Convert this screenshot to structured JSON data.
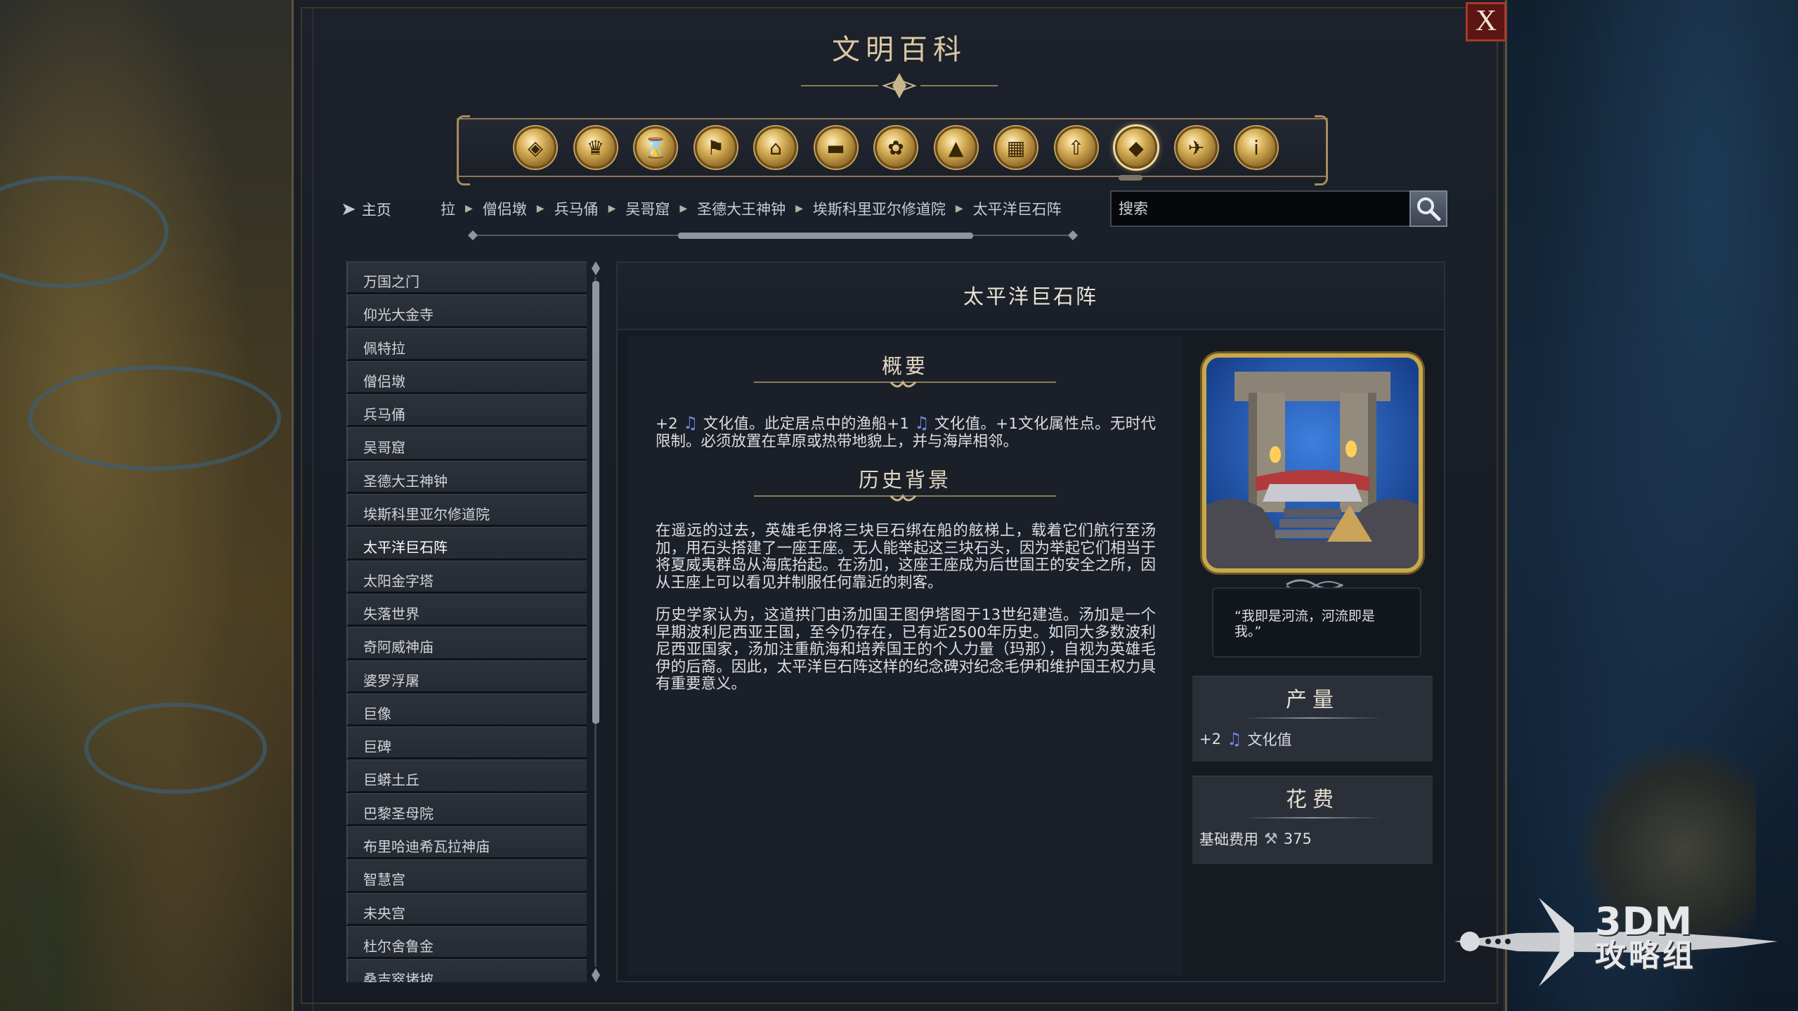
{
  "window": {
    "title": "文明百科",
    "close_label": "X"
  },
  "categories": [
    {
      "icon": "civilization-icon",
      "glyph": "◈"
    },
    {
      "icon": "leader-icon",
      "glyph": "♛"
    },
    {
      "icon": "era-hourglass-icon",
      "glyph": "⌛"
    },
    {
      "icon": "flag-icon",
      "glyph": "⚑"
    },
    {
      "icon": "building-icon",
      "glyph": "⌂"
    },
    {
      "icon": "district-icon",
      "glyph": "▬"
    },
    {
      "icon": "culture-icon",
      "glyph": "✿"
    },
    {
      "icon": "terrain-mountain-icon",
      "glyph": "▲"
    },
    {
      "icon": "city-icon",
      "glyph": "▦"
    },
    {
      "icon": "advance-arrow-icon",
      "glyph": "⇧"
    },
    {
      "icon": "wonder-icon",
      "glyph": "◆",
      "active": true
    },
    {
      "icon": "dove-icon",
      "glyph": "✈"
    },
    {
      "icon": "info-icon",
      "glyph": "i"
    }
  ],
  "nav": {
    "home_label": "主页",
    "breadcrumb": [
      "拉",
      "僧侣墩",
      "兵马俑",
      "吴哥窟",
      "圣德大王神钟",
      "埃斯科里亚尔修道院",
      "太平洋巨石阵"
    ]
  },
  "search": {
    "placeholder": "搜索"
  },
  "list": {
    "items": [
      "万国之门",
      "仰光大金寺",
      "佩特拉",
      "僧侣墩",
      "兵马俑",
      "吴哥窟",
      "圣德大王神钟",
      "埃斯科里亚尔修道院",
      "太平洋巨石阵",
      "太阳金字塔",
      "失落世界",
      "奇阿威神庙",
      "婆罗浮屠",
      "巨像",
      "巨碑",
      "巨蟒土丘",
      "巴黎圣母院",
      "布里哈迪希瓦拉神庙",
      "智慧宫",
      "未央宫",
      "杜尔舍鲁金",
      "桑吉窣堵坡"
    ],
    "selected": "太平洋巨石阵"
  },
  "detail": {
    "title": "太平洋巨石阵",
    "overview_heading": "概要",
    "overview_text_1": "+2",
    "overview_text_2": " 文化值。此定居点中的渔船+1 ",
    "overview_text_3": " 文化值。+1文化属性点。无时代限制。必须放置在草原或热带地貌上，并与海岸相邻。",
    "history_heading": "历史背景",
    "history_para_1": "在遥远的过去，英雄毛伊将三块巨石绑在船的舷梯上，载着它们航行至汤加，用石头搭建了一座王座。无人能举起这三块石头，因为举起它们相当于将夏威夷群岛从海底抬起。在汤加，这座王座成为后世国王的安全之所，因从王座上可以看见并制服任何靠近的刺客。",
    "history_para_2": "历史学家认为，这道拱门由汤加国王图伊塔图于13世纪建造。汤加是一个早期波利尼西亚王国，至今仍存在，已有近2500年历史。如同大多数波利尼西亚国家，汤加注重航海和培养国王的个人力量（玛那），自视为英雄毛伊的后裔。因此，太平洋巨石阵这样的纪念碑对纪念毛伊和维护国王权力具有重要意义。",
    "quote": "“我即是河流，河流即是我。”",
    "yield_heading": "产量",
    "yield_amount": "+2",
    "yield_label": "文化值",
    "cost_heading": "花费",
    "cost_label": "基础费用",
    "cost_value": "375"
  },
  "watermark": {
    "line1": "3DM",
    "line2": "攻略组"
  },
  "colors": {
    "accent_gold": "#c9a84c",
    "culture_note": "#6e86ea",
    "close_red": "#5b1513"
  }
}
